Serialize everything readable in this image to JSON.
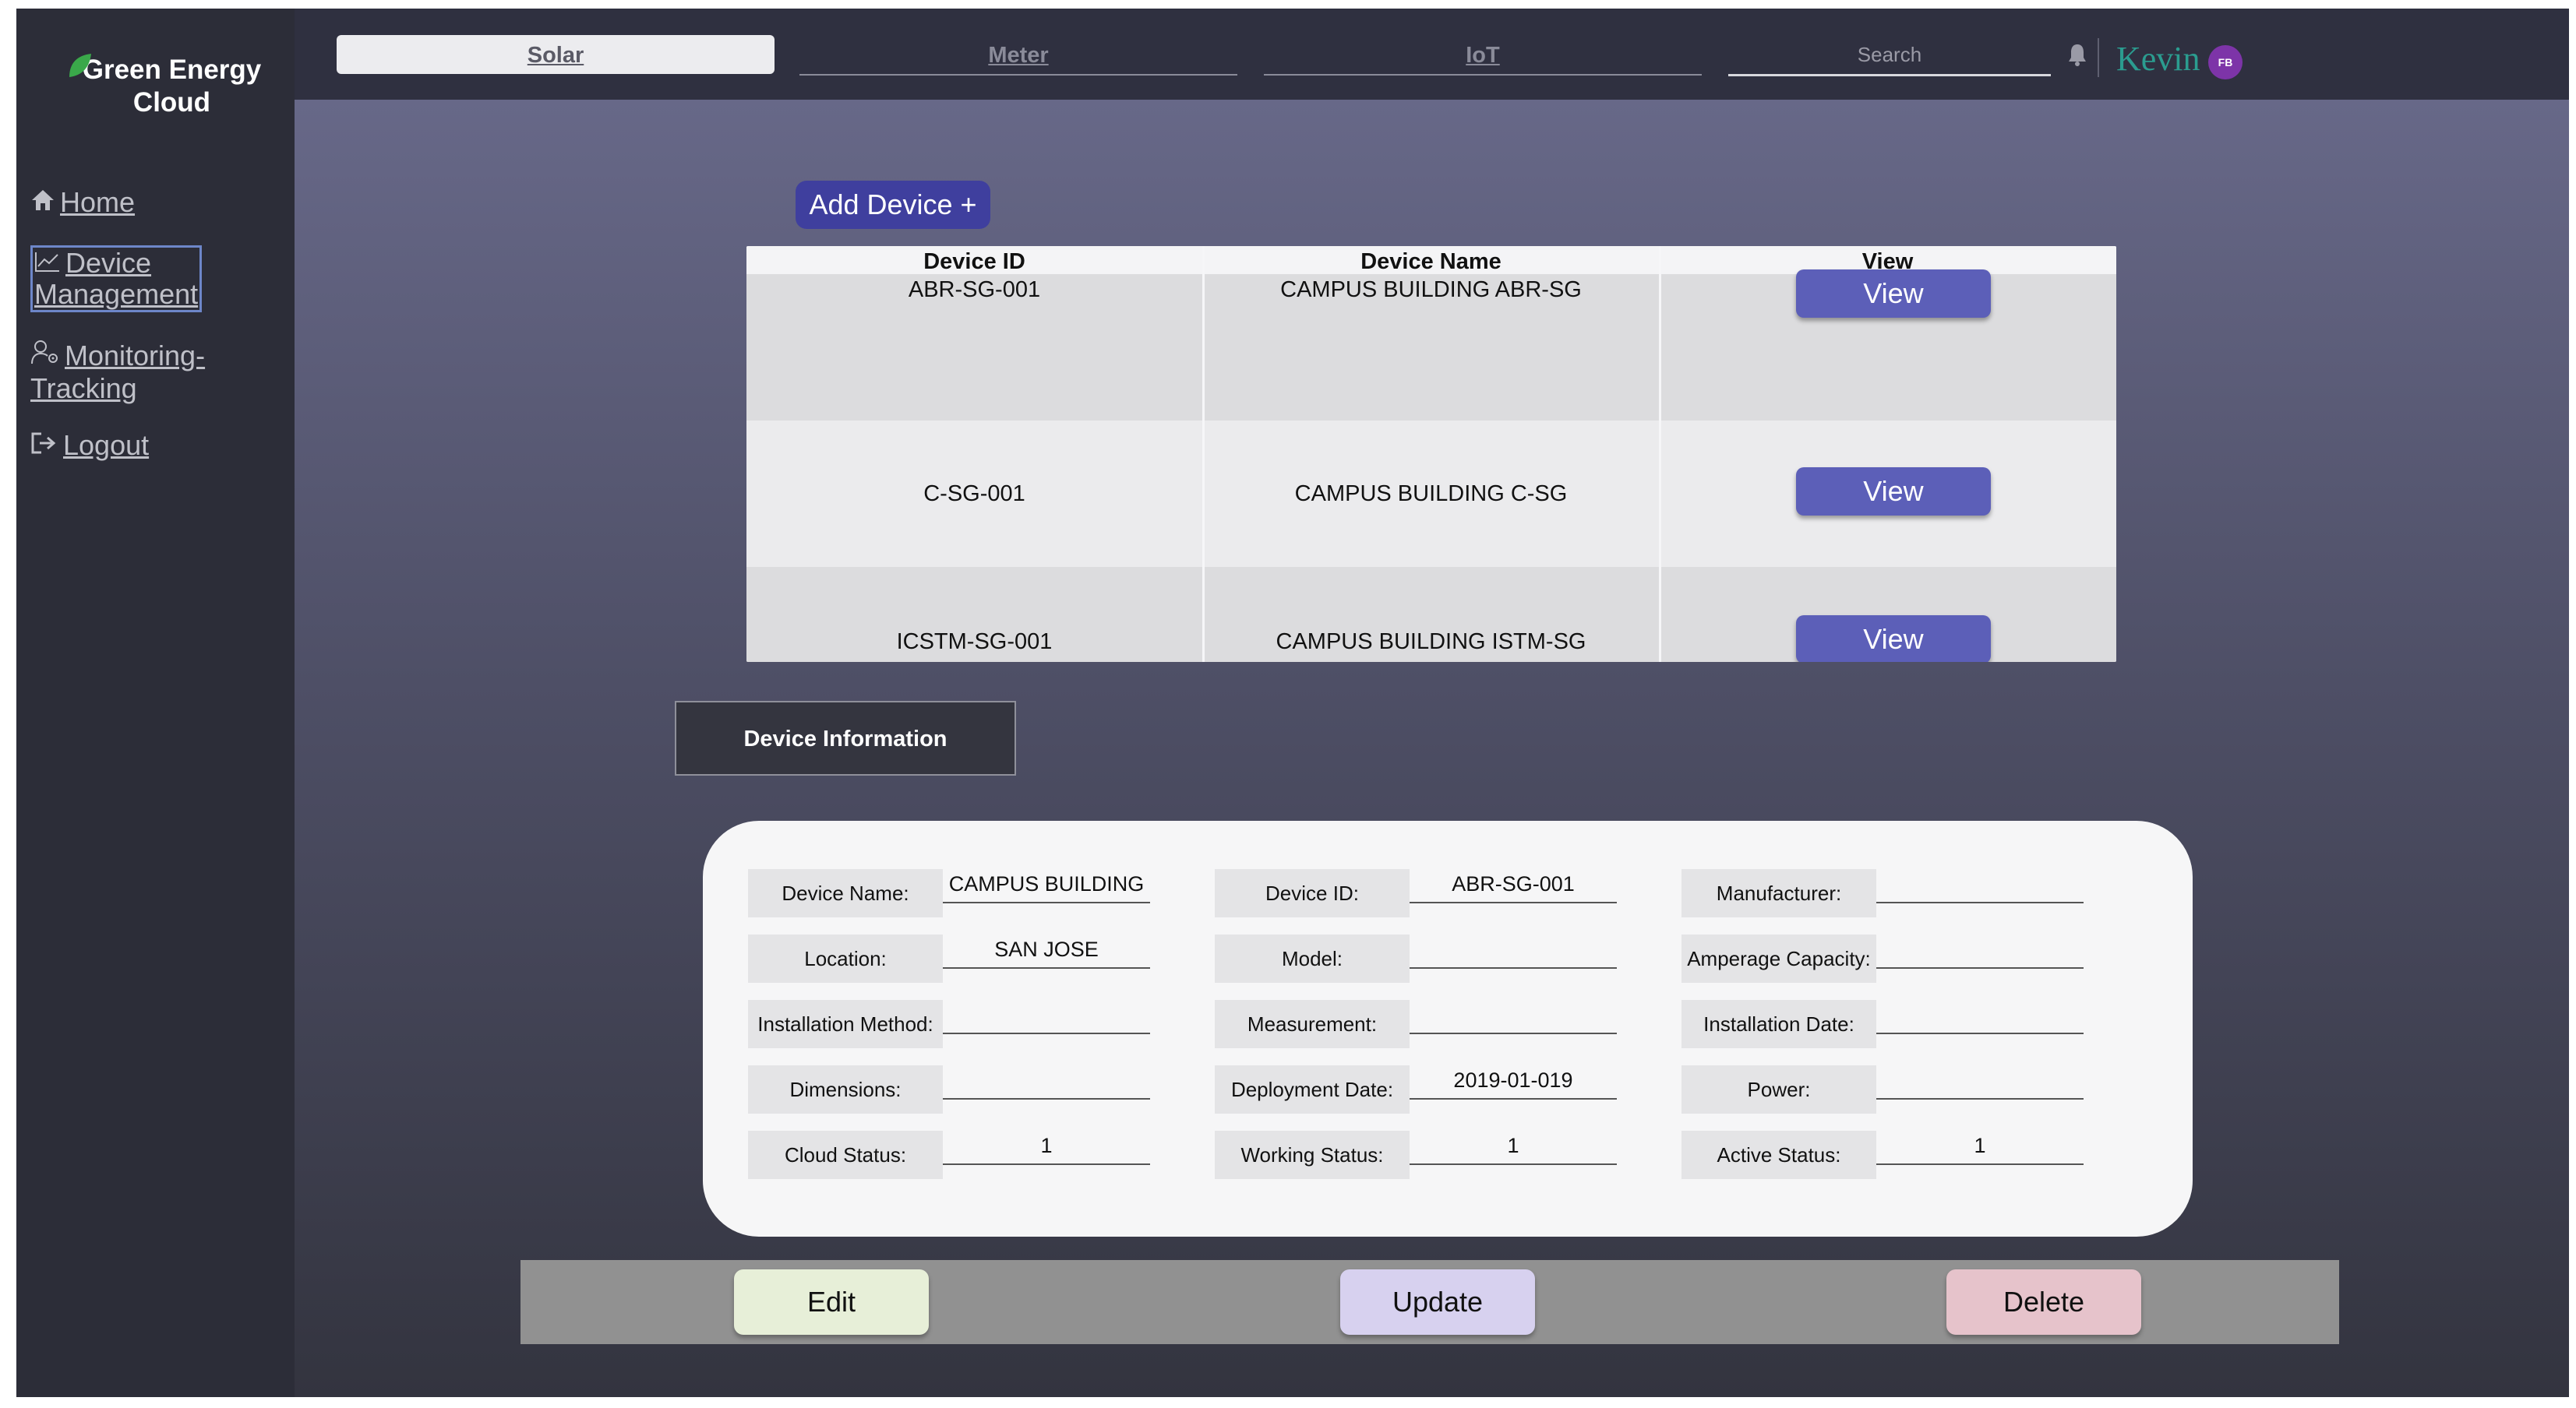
{
  "brand": {
    "line1": "Green Energy",
    "line2": "Cloud",
    "accent": "#3aa84a"
  },
  "sidebar": {
    "items": [
      {
        "label": "Home",
        "icon": "home-icon"
      },
      {
        "label": "Device Management",
        "icon": "chart-line-icon",
        "active": true
      },
      {
        "label": "Monitoring-Tracking",
        "icon": "user-gear-icon"
      },
      {
        "label": "Logout",
        "icon": "logout-icon"
      }
    ]
  },
  "topbar": {
    "tabs": [
      {
        "label": "Solar",
        "active": true
      },
      {
        "label": "Meter"
      },
      {
        "label": "IoT"
      }
    ],
    "search_placeholder": "Search",
    "username": "Kevin",
    "avatar_initials": "FB",
    "accent_color": "#2b9c8f"
  },
  "devices": {
    "add_label": "Add Device +",
    "columns": [
      "Device ID",
      "Device Name",
      "View"
    ],
    "rows": [
      {
        "id": "ABR-SG-001",
        "name": "CAMPUS BUILDING ABR-SG",
        "action": "View"
      },
      {
        "id": "C-SG-001",
        "name": "CAMPUS BUILDING C-SG",
        "action": "View"
      },
      {
        "id": "ICSTM-SG-001",
        "name": "CAMPUS BUILDING ISTM-SG",
        "action": "View"
      }
    ]
  },
  "info": {
    "tab_label": "Device Information",
    "fields": [
      {
        "label": "Device Name:",
        "value": "CAMPUS BUILDING"
      },
      {
        "label": "Device ID:",
        "value": "ABR-SG-001"
      },
      {
        "label": "Manufacturer:",
        "value": ""
      },
      {
        "label": "Location:",
        "value": "SAN JOSE"
      },
      {
        "label": "Model:",
        "value": ""
      },
      {
        "label": "Amperage Capacity:",
        "value": ""
      },
      {
        "label": "Installation Method:",
        "value": ""
      },
      {
        "label": "Measurement:",
        "value": ""
      },
      {
        "label": "Installation Date:",
        "value": ""
      },
      {
        "label": "Dimensions:",
        "value": ""
      },
      {
        "label": "Deployment Date:",
        "value": "2019-01-019"
      },
      {
        "label": "Power:",
        "value": ""
      },
      {
        "label": "Cloud Status:",
        "value": "1"
      },
      {
        "label": "Working Status:",
        "value": "1"
      },
      {
        "label": "Active Status:",
        "value": "1"
      }
    ]
  },
  "actions": {
    "edit": "Edit",
    "update": "Update",
    "delete": "Delete"
  }
}
